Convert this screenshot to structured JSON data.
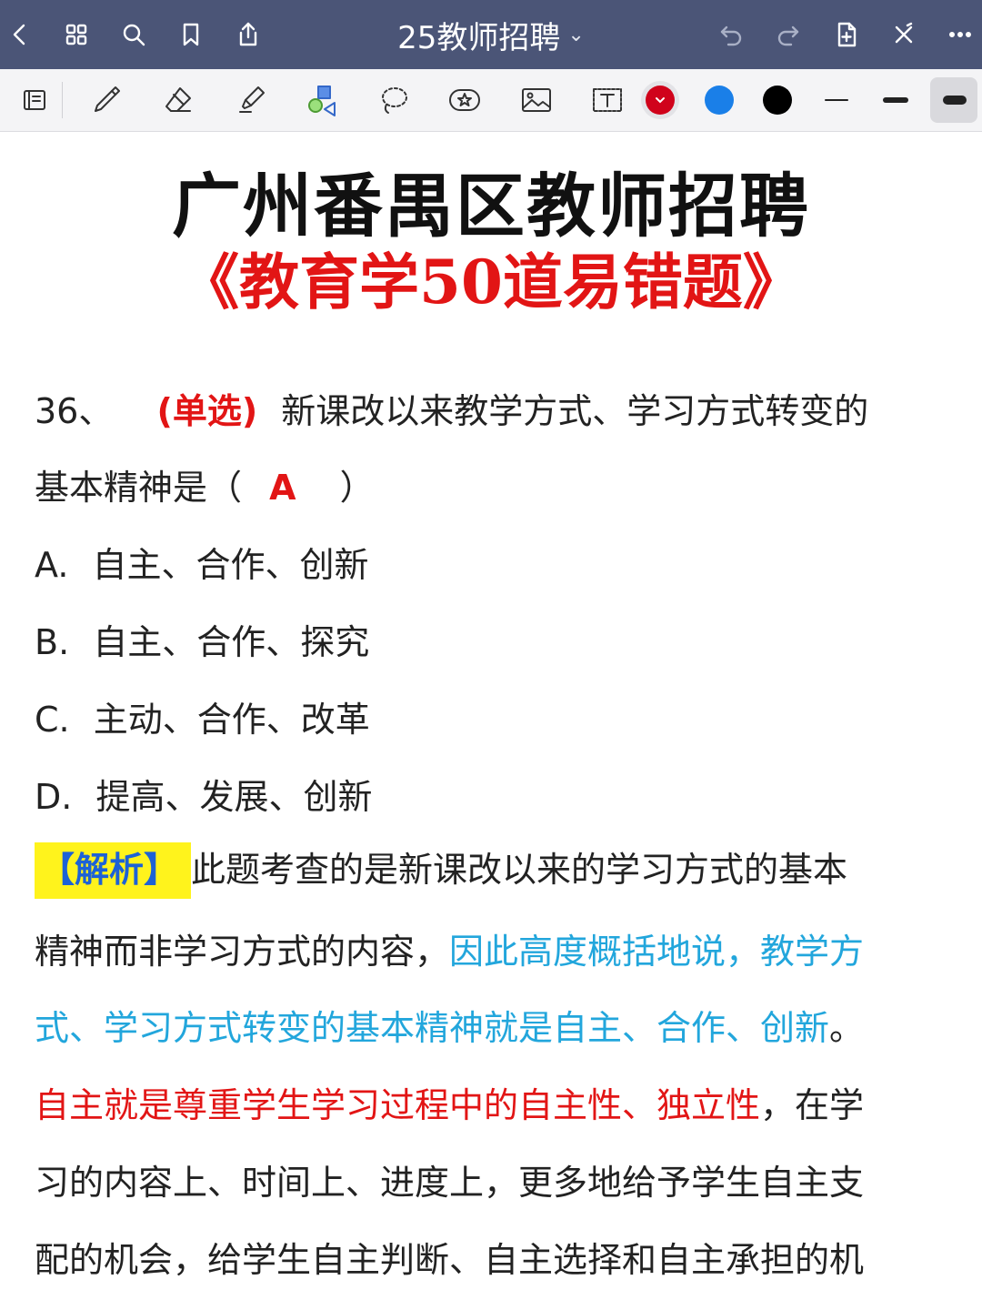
{
  "app": {
    "title": "25教师招聘",
    "title_caret": "⌄",
    "accent": "#4b5577"
  },
  "toolbar": {
    "colors": [
      "#d0021b",
      "#1a7fe8",
      "#000000"
    ],
    "selected_color": "#d0021b"
  },
  "document": {
    "title_main": "广州番禺区教师招聘",
    "title_sub": "《教育学50道易错题》",
    "question": {
      "number": "36、",
      "type": "(单选)",
      "stem_1": "新课改以来教学方式、学习方式转变的",
      "stem_2a": "基本精神是（",
      "answer": "A",
      "stem_2b": "）",
      "options": [
        {
          "letter": "A.",
          "text": "自主、合作、创新"
        },
        {
          "letter": "B.",
          "text": "自主、合作、探究"
        },
        {
          "letter": "C.",
          "text": "主动、合作、改革"
        },
        {
          "letter": "D.",
          "text": "提高、发展、创新"
        }
      ]
    },
    "analysis": {
      "label": "【解析】",
      "l1": "此题考查的是新课改以来的学习方式的基本",
      "l2a": "精神而非学习方式的内容，",
      "l2b": "因此高度概括地说，教学方",
      "l3a": "式、学习方式转变的基本精神就是自主、合作、创新",
      "l3b": "。",
      "l4a": "自主就是尊重学生学习过程中的自主性、独立性",
      "l4b": "，在学",
      "l5": "习的内容上、时间上、进度上，更多地给予学生自主支",
      "l6": "配的机会，给学生自主判断、自主选择和自主承担的机"
    }
  }
}
